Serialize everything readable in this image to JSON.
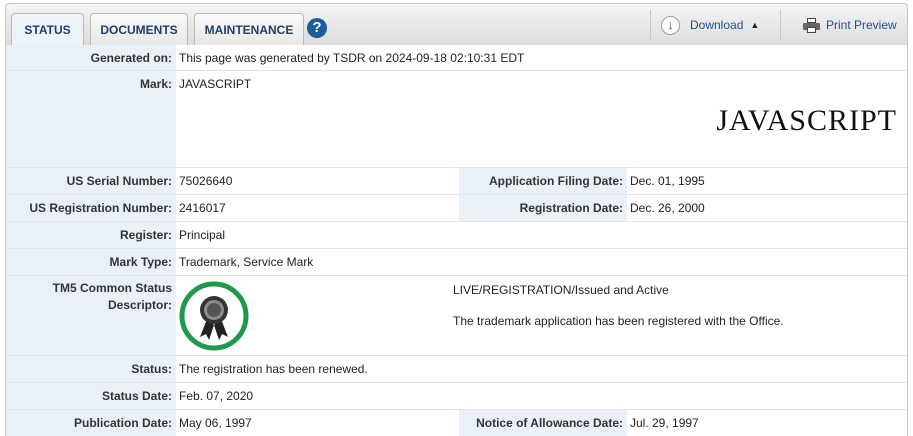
{
  "tabs": [
    {
      "label": "STATUS",
      "active": true
    },
    {
      "label": "DOCUMENTS",
      "active": false
    },
    {
      "label": "MAINTENANCE",
      "active": false
    }
  ],
  "help": {
    "label": "?"
  },
  "toolbar": {
    "download_label": "Download",
    "download_caret": "▲",
    "download_arrow": "↓",
    "print_label": "Print Preview"
  },
  "fields": {
    "generated_on": {
      "label": "Generated on:",
      "value": "This page was generated by TSDR on 2024-09-18 02:10:31 EDT"
    },
    "mark": {
      "label": "Mark:",
      "value": "JAVASCRIPT",
      "display": "JAVASCRIPT"
    },
    "serial": {
      "label": "US Serial Number:",
      "value": "75026640"
    },
    "filing_date": {
      "label": "Application Filing Date:",
      "value": "Dec. 01, 1995"
    },
    "registration_number": {
      "label": "US Registration Number:",
      "value": "2416017"
    },
    "registration_date": {
      "label": "Registration Date:",
      "value": "Dec. 26, 2000"
    },
    "register": {
      "label": "Register:",
      "value": "Principal"
    },
    "mark_type": {
      "label": "Mark Type:",
      "value": "Trademark, Service Mark"
    },
    "tm5": {
      "label_line1": "TM5 Common Status",
      "label_line2": "Descriptor:",
      "status_line": "LIVE/REGISTRATION/Issued and Active",
      "description": "The trademark application has been registered with the Office."
    },
    "status": {
      "label": "Status:",
      "value": "The registration has been renewed."
    },
    "status_date": {
      "label": "Status Date:",
      "value": "Feb. 07, 2020"
    },
    "publication_date": {
      "label": "Publication Date:",
      "value": "May 06, 1997"
    },
    "allowance_date": {
      "label": "Notice of Allowance Date:",
      "value": "Jul. 29, 1997"
    }
  },
  "colors": {
    "label_bg": "#eaf0f8",
    "tab_text": "#1f3f66",
    "badge_ring": "#1e9a4a",
    "link": "#1f4f8a"
  }
}
